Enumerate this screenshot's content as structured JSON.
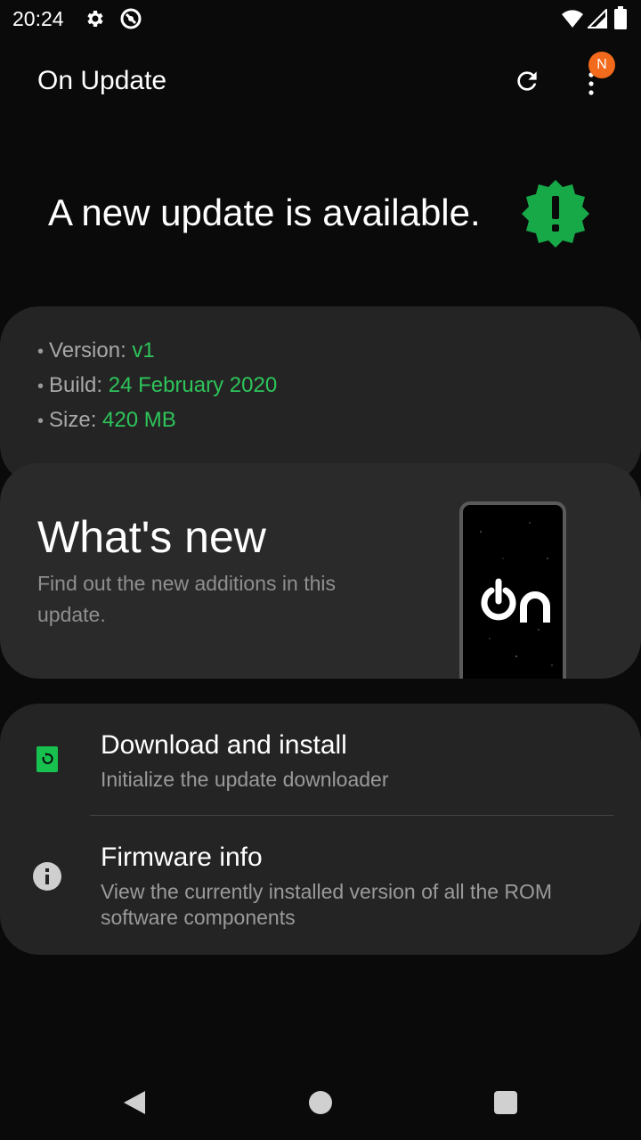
{
  "status_bar": {
    "time": "20:24",
    "icons": [
      "gear-icon",
      "dnd-icon",
      "wifi-icon",
      "signal-icon",
      "battery-icon"
    ]
  },
  "app_bar": {
    "title": "On Update",
    "notification_badge": "N",
    "icons": [
      "refresh-icon",
      "more-vert-icon"
    ]
  },
  "hero": {
    "message": "A new update is available.",
    "icon": "alert-badge-icon",
    "accent_color": "#17a848"
  },
  "update_info": {
    "items": [
      {
        "label": "Version: ",
        "value": "v1"
      },
      {
        "label": "Build: ",
        "value": "24 February 2020"
      },
      {
        "label": "Size: ",
        "value": "420 MB"
      }
    ],
    "bullet": "•",
    "value_color": "#2ec45a"
  },
  "whats_new": {
    "title": "What's new",
    "description": "Find out the new additions in this update.",
    "logo_text": "On"
  },
  "actions": [
    {
      "title": "Download and install",
      "subtitle": "Initialize the update downloader",
      "icon": "download-install-icon"
    },
    {
      "title": "Firmware info",
      "subtitle": "View the currently installed version of all the ROM software components",
      "icon": "info-icon"
    }
  ],
  "nav_bar": {
    "icons": [
      "back-icon",
      "home-icon",
      "recents-icon"
    ]
  }
}
